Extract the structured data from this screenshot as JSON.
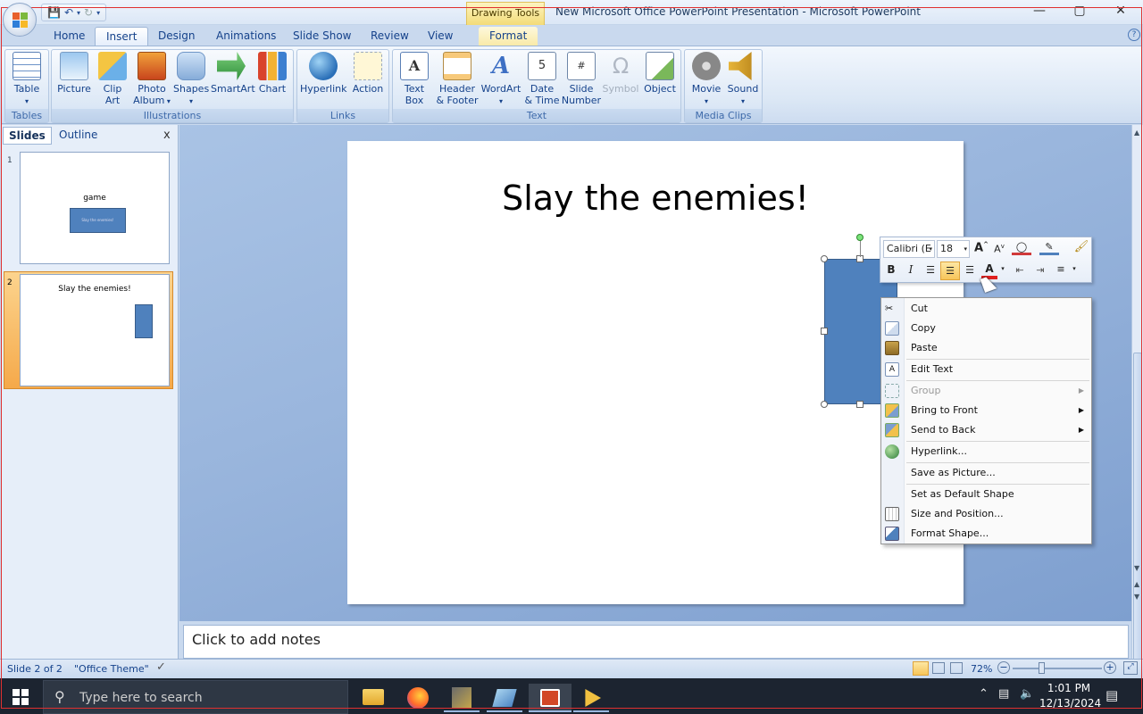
{
  "window": {
    "title": "New Microsoft Office PowerPoint Presentation - Microsoft PowerPoint",
    "contextual_tab_group": "Drawing Tools",
    "controls": [
      "—",
      "▢",
      "✕"
    ]
  },
  "ribbon_tabs": [
    "Home",
    "Insert",
    "Design",
    "Animations",
    "Slide Show",
    "Review",
    "View",
    "Format"
  ],
  "active_tab": "Insert",
  "ribbon": {
    "tables": {
      "name": "Tables",
      "buttons": [
        {
          "label": "Table",
          "label2": ""
        }
      ]
    },
    "illustrations": {
      "name": "Illustrations",
      "buttons": [
        {
          "label": "Picture",
          "label2": ""
        },
        {
          "label": "Clip",
          "label2": "Art"
        },
        {
          "label": "Photo",
          "label2": "Album"
        },
        {
          "label": "Shapes",
          "label2": ""
        },
        {
          "label": "SmartArt",
          "label2": ""
        },
        {
          "label": "Chart",
          "label2": ""
        }
      ]
    },
    "links": {
      "name": "Links",
      "buttons": [
        {
          "label": "Hyperlink",
          "label2": ""
        },
        {
          "label": "Action",
          "label2": ""
        }
      ]
    },
    "text": {
      "name": "Text",
      "buttons": [
        {
          "label": "Text",
          "label2": "Box"
        },
        {
          "label": "Header",
          "label2": "& Footer"
        },
        {
          "label": "WordArt",
          "label2": ""
        },
        {
          "label": "Date",
          "label2": "& Time"
        },
        {
          "label": "Slide",
          "label2": "Number"
        },
        {
          "label": "Symbol",
          "label2": ""
        },
        {
          "label": "Object",
          "label2": ""
        }
      ]
    },
    "media": {
      "name": "Media Clips",
      "buttons": [
        {
          "label": "Movie",
          "label2": ""
        },
        {
          "label": "Sound",
          "label2": ""
        }
      ]
    }
  },
  "left_pane": {
    "tabs": [
      "Slides",
      "Outline"
    ],
    "close": "x",
    "slides": [
      {
        "number": "1",
        "title": "game",
        "shape_text": "Slay the enemies!"
      },
      {
        "number": "2",
        "title": "Slay the enemies!"
      }
    ]
  },
  "slide": {
    "title": "Slay the enemies!"
  },
  "notes": {
    "placeholder": "Click to add notes"
  },
  "mini_toolbar": {
    "font": "Calibri (E",
    "size": "18",
    "bold": "B",
    "italic": "I",
    "font_color_letter": "A",
    "grow": "A",
    "shrink": "A"
  },
  "context_menu": [
    {
      "label": "Cut",
      "icon": "scissors-icon",
      "submenu": false,
      "disabled": false
    },
    {
      "label": "Copy",
      "icon": "copy-icon",
      "submenu": false,
      "disabled": false
    },
    {
      "label": "Paste",
      "icon": "paste-icon",
      "submenu": false,
      "disabled": false
    },
    {
      "label": "Edit Text",
      "icon": "edit-text-icon",
      "submenu": false,
      "disabled": false
    },
    {
      "label": "Group",
      "icon": "group-icon",
      "submenu": true,
      "disabled": true
    },
    {
      "label": "Bring to Front",
      "icon": "bring-front-icon",
      "submenu": true,
      "disabled": false
    },
    {
      "label": "Send to Back",
      "icon": "send-back-icon",
      "submenu": true,
      "disabled": false
    },
    {
      "label": "Hyperlink...",
      "icon": "hyperlink-icon",
      "submenu": false,
      "disabled": false
    },
    {
      "label": "Save as Picture...",
      "icon": "",
      "submenu": false,
      "disabled": false
    },
    {
      "label": "Set as Default Shape",
      "icon": "",
      "submenu": false,
      "disabled": false
    },
    {
      "label": "Size and Position...",
      "icon": "size-position-icon",
      "submenu": false,
      "disabled": false
    },
    {
      "label": "Format Shape...",
      "icon": "format-shape-icon",
      "submenu": false,
      "disabled": false
    }
  ],
  "status": {
    "slide": "Slide 2 of 2",
    "theme": "\"Office Theme\"",
    "zoom": "72%"
  },
  "taskbar": {
    "search_placeholder": "Type here to search",
    "time": "1:01 PM",
    "date": "12/13/2024"
  },
  "colors": {
    "shape": "#4f81bd",
    "accent": "#15428b",
    "selected_thumb": "#f5a94a"
  }
}
